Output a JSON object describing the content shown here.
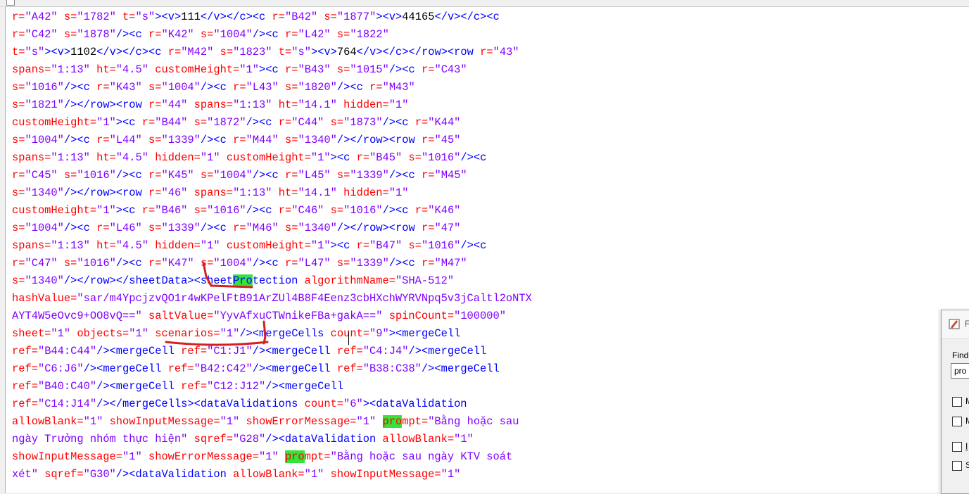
{
  "lines": [
    [
      {
        "t": "r=",
        "c": "attr"
      },
      {
        "t": "\"A42\"",
        "c": "val"
      },
      {
        "t": " s=",
        "c": "attr"
      },
      {
        "t": "\"1782\"",
        "c": "val"
      },
      {
        "t": " t=",
        "c": "attr"
      },
      {
        "t": "\"s\"",
        "c": "val"
      },
      {
        "t": "><v>",
        "c": "tag"
      },
      {
        "t": "111",
        "c": "text"
      },
      {
        "t": "</v></c><c",
        "c": "tag"
      },
      {
        "t": " r=",
        "c": "attr"
      },
      {
        "t": "\"B42\"",
        "c": "val"
      },
      {
        "t": " s=",
        "c": "attr"
      },
      {
        "t": "\"1877\"",
        "c": "val"
      },
      {
        "t": "><v>",
        "c": "tag"
      },
      {
        "t": "44165",
        "c": "text"
      },
      {
        "t": "</v></c><c",
        "c": "tag"
      }
    ],
    [
      {
        "t": "r=",
        "c": "attr"
      },
      {
        "t": "\"C42\"",
        "c": "val"
      },
      {
        "t": " s=",
        "c": "attr"
      },
      {
        "t": "\"1878\"",
        "c": "val"
      },
      {
        "t": "/><c",
        "c": "tag"
      },
      {
        "t": " r=",
        "c": "attr"
      },
      {
        "t": "\"K42\"",
        "c": "val"
      },
      {
        "t": " s=",
        "c": "attr"
      },
      {
        "t": "\"1004\"",
        "c": "val"
      },
      {
        "t": "/><c",
        "c": "tag"
      },
      {
        "t": " r=",
        "c": "attr"
      },
      {
        "t": "\"L42\"",
        "c": "val"
      },
      {
        "t": " s=",
        "c": "attr"
      },
      {
        "t": "\"1822\"",
        "c": "val"
      }
    ],
    [
      {
        "t": "t=",
        "c": "attr"
      },
      {
        "t": "\"s\"",
        "c": "val"
      },
      {
        "t": "><v>",
        "c": "tag"
      },
      {
        "t": "1102",
        "c": "text"
      },
      {
        "t": "</v></c><c",
        "c": "tag"
      },
      {
        "t": " r=",
        "c": "attr"
      },
      {
        "t": "\"M42\"",
        "c": "val"
      },
      {
        "t": " s=",
        "c": "attr"
      },
      {
        "t": "\"1823\"",
        "c": "val"
      },
      {
        "t": " t=",
        "c": "attr"
      },
      {
        "t": "\"s\"",
        "c": "val"
      },
      {
        "t": "><v>",
        "c": "tag"
      },
      {
        "t": "764",
        "c": "text"
      },
      {
        "t": "</v></c></row><row",
        "c": "tag"
      },
      {
        "t": " r=",
        "c": "attr"
      },
      {
        "t": "\"43\"",
        "c": "val"
      }
    ],
    [
      {
        "t": "spans=",
        "c": "attr"
      },
      {
        "t": "\"1:13\"",
        "c": "val"
      },
      {
        "t": " ht=",
        "c": "attr"
      },
      {
        "t": "\"4.5\"",
        "c": "val"
      },
      {
        "t": " customHeight=",
        "c": "attr"
      },
      {
        "t": "\"1\"",
        "c": "val"
      },
      {
        "t": "><c",
        "c": "tag"
      },
      {
        "t": " r=",
        "c": "attr"
      },
      {
        "t": "\"B43\"",
        "c": "val"
      },
      {
        "t": " s=",
        "c": "attr"
      },
      {
        "t": "\"1015\"",
        "c": "val"
      },
      {
        "t": "/><c",
        "c": "tag"
      },
      {
        "t": " r=",
        "c": "attr"
      },
      {
        "t": "\"C43\"",
        "c": "val"
      }
    ],
    [
      {
        "t": "s=",
        "c": "attr"
      },
      {
        "t": "\"1016\"",
        "c": "val"
      },
      {
        "t": "/><c",
        "c": "tag"
      },
      {
        "t": " r=",
        "c": "attr"
      },
      {
        "t": "\"K43\"",
        "c": "val"
      },
      {
        "t": " s=",
        "c": "attr"
      },
      {
        "t": "\"1004\"",
        "c": "val"
      },
      {
        "t": "/><c",
        "c": "tag"
      },
      {
        "t": " r=",
        "c": "attr"
      },
      {
        "t": "\"L43\"",
        "c": "val"
      },
      {
        "t": " s=",
        "c": "attr"
      },
      {
        "t": "\"1820\"",
        "c": "val"
      },
      {
        "t": "/><c",
        "c": "tag"
      },
      {
        "t": " r=",
        "c": "attr"
      },
      {
        "t": "\"M43\"",
        "c": "val"
      }
    ],
    [
      {
        "t": "s=",
        "c": "attr"
      },
      {
        "t": "\"1821\"",
        "c": "val"
      },
      {
        "t": "/></row><row",
        "c": "tag"
      },
      {
        "t": " r=",
        "c": "attr"
      },
      {
        "t": "\"44\"",
        "c": "val"
      },
      {
        "t": " spans=",
        "c": "attr"
      },
      {
        "t": "\"1:13\"",
        "c": "val"
      },
      {
        "t": " ht=",
        "c": "attr"
      },
      {
        "t": "\"14.1\"",
        "c": "val"
      },
      {
        "t": " hidden=",
        "c": "attr"
      },
      {
        "t": "\"1\"",
        "c": "val"
      }
    ],
    [
      {
        "t": "customHeight=",
        "c": "attr"
      },
      {
        "t": "\"1\"",
        "c": "val"
      },
      {
        "t": "><c",
        "c": "tag"
      },
      {
        "t": " r=",
        "c": "attr"
      },
      {
        "t": "\"B44\"",
        "c": "val"
      },
      {
        "t": " s=",
        "c": "attr"
      },
      {
        "t": "\"1872\"",
        "c": "val"
      },
      {
        "t": "/><c",
        "c": "tag"
      },
      {
        "t": " r=",
        "c": "attr"
      },
      {
        "t": "\"C44\"",
        "c": "val"
      },
      {
        "t": " s=",
        "c": "attr"
      },
      {
        "t": "\"1873\"",
        "c": "val"
      },
      {
        "t": "/><c",
        "c": "tag"
      },
      {
        "t": " r=",
        "c": "attr"
      },
      {
        "t": "\"K44\"",
        "c": "val"
      }
    ],
    [
      {
        "t": "s=",
        "c": "attr"
      },
      {
        "t": "\"1004\"",
        "c": "val"
      },
      {
        "t": "/><c",
        "c": "tag"
      },
      {
        "t": " r=",
        "c": "attr"
      },
      {
        "t": "\"L44\"",
        "c": "val"
      },
      {
        "t": " s=",
        "c": "attr"
      },
      {
        "t": "\"1339\"",
        "c": "val"
      },
      {
        "t": "/><c",
        "c": "tag"
      },
      {
        "t": " r=",
        "c": "attr"
      },
      {
        "t": "\"M44\"",
        "c": "val"
      },
      {
        "t": " s=",
        "c": "attr"
      },
      {
        "t": "\"1340\"",
        "c": "val"
      },
      {
        "t": "/></row><row",
        "c": "tag"
      },
      {
        "t": " r=",
        "c": "attr"
      },
      {
        "t": "\"45\"",
        "c": "val"
      }
    ],
    [
      {
        "t": "spans=",
        "c": "attr"
      },
      {
        "t": "\"1:13\"",
        "c": "val"
      },
      {
        "t": " ht=",
        "c": "attr"
      },
      {
        "t": "\"4.5\"",
        "c": "val"
      },
      {
        "t": " hidden=",
        "c": "attr"
      },
      {
        "t": "\"1\"",
        "c": "val"
      },
      {
        "t": " customHeight=",
        "c": "attr"
      },
      {
        "t": "\"1\"",
        "c": "val"
      },
      {
        "t": "><c",
        "c": "tag"
      },
      {
        "t": " r=",
        "c": "attr"
      },
      {
        "t": "\"B45\"",
        "c": "val"
      },
      {
        "t": " s=",
        "c": "attr"
      },
      {
        "t": "\"1016\"",
        "c": "val"
      },
      {
        "t": "/><c",
        "c": "tag"
      }
    ],
    [
      {
        "t": "r=",
        "c": "attr"
      },
      {
        "t": "\"C45\"",
        "c": "val"
      },
      {
        "t": " s=",
        "c": "attr"
      },
      {
        "t": "\"1016\"",
        "c": "val"
      },
      {
        "t": "/><c",
        "c": "tag"
      },
      {
        "t": " r=",
        "c": "attr"
      },
      {
        "t": "\"K45\"",
        "c": "val"
      },
      {
        "t": " s=",
        "c": "attr"
      },
      {
        "t": "\"1004\"",
        "c": "val"
      },
      {
        "t": "/><c",
        "c": "tag"
      },
      {
        "t": " r=",
        "c": "attr"
      },
      {
        "t": "\"L45\"",
        "c": "val"
      },
      {
        "t": " s=",
        "c": "attr"
      },
      {
        "t": "\"1339\"",
        "c": "val"
      },
      {
        "t": "/><c",
        "c": "tag"
      },
      {
        "t": " r=",
        "c": "attr"
      },
      {
        "t": "\"M45\"",
        "c": "val"
      }
    ],
    [
      {
        "t": "s=",
        "c": "attr"
      },
      {
        "t": "\"1340\"",
        "c": "val"
      },
      {
        "t": "/></row><row",
        "c": "tag"
      },
      {
        "t": " r=",
        "c": "attr"
      },
      {
        "t": "\"46\"",
        "c": "val"
      },
      {
        "t": " spans=",
        "c": "attr"
      },
      {
        "t": "\"1:13\"",
        "c": "val"
      },
      {
        "t": " ht=",
        "c": "attr"
      },
      {
        "t": "\"14.1\"",
        "c": "val"
      },
      {
        "t": " hidden=",
        "c": "attr"
      },
      {
        "t": "\"1\"",
        "c": "val"
      }
    ],
    [
      {
        "t": "customHeight=",
        "c": "attr"
      },
      {
        "t": "\"1\"",
        "c": "val"
      },
      {
        "t": "><c",
        "c": "tag"
      },
      {
        "t": " r=",
        "c": "attr"
      },
      {
        "t": "\"B46\"",
        "c": "val"
      },
      {
        "t": " s=",
        "c": "attr"
      },
      {
        "t": "\"1016\"",
        "c": "val"
      },
      {
        "t": "/><c",
        "c": "tag"
      },
      {
        "t": " r=",
        "c": "attr"
      },
      {
        "t": "\"C46\"",
        "c": "val"
      },
      {
        "t": " s=",
        "c": "attr"
      },
      {
        "t": "\"1016\"",
        "c": "val"
      },
      {
        "t": "/><c",
        "c": "tag"
      },
      {
        "t": " r=",
        "c": "attr"
      },
      {
        "t": "\"K46\"",
        "c": "val"
      }
    ],
    [
      {
        "t": "s=",
        "c": "attr"
      },
      {
        "t": "\"1004\"",
        "c": "val"
      },
      {
        "t": "/><c",
        "c": "tag"
      },
      {
        "t": " r=",
        "c": "attr"
      },
      {
        "t": "\"L46\"",
        "c": "val"
      },
      {
        "t": " s=",
        "c": "attr"
      },
      {
        "t": "\"1339\"",
        "c": "val"
      },
      {
        "t": "/><c",
        "c": "tag"
      },
      {
        "t": " r=",
        "c": "attr"
      },
      {
        "t": "\"M46\"",
        "c": "val"
      },
      {
        "t": " s=",
        "c": "attr"
      },
      {
        "t": "\"1340\"",
        "c": "val"
      },
      {
        "t": "/></row><row",
        "c": "tag"
      },
      {
        "t": " r=",
        "c": "attr"
      },
      {
        "t": "\"47\"",
        "c": "val"
      }
    ],
    [
      {
        "t": "spans=",
        "c": "attr"
      },
      {
        "t": "\"1:13\"",
        "c": "val"
      },
      {
        "t": " ht=",
        "c": "attr"
      },
      {
        "t": "\"4.5\"",
        "c": "val"
      },
      {
        "t": " hidden=",
        "c": "attr"
      },
      {
        "t": "\"1\"",
        "c": "val"
      },
      {
        "t": " customHeight=",
        "c": "attr"
      },
      {
        "t": "\"1\"",
        "c": "val"
      },
      {
        "t": "><c",
        "c": "tag"
      },
      {
        "t": " r=",
        "c": "attr"
      },
      {
        "t": "\"B47\"",
        "c": "val"
      },
      {
        "t": " s=",
        "c": "attr"
      },
      {
        "t": "\"1016\"",
        "c": "val"
      },
      {
        "t": "/><c",
        "c": "tag"
      }
    ],
    [
      {
        "t": "r=",
        "c": "attr"
      },
      {
        "t": "\"C47\"",
        "c": "val"
      },
      {
        "t": " s=",
        "c": "attr"
      },
      {
        "t": "\"1016\"",
        "c": "val"
      },
      {
        "t": "/><c",
        "c": "tag"
      },
      {
        "t": " r=",
        "c": "attr"
      },
      {
        "t": "\"K47\"",
        "c": "val"
      },
      {
        "t": " s=",
        "c": "attr"
      },
      {
        "t": "\"1004\"",
        "c": "val"
      },
      {
        "t": "/><c",
        "c": "tag"
      },
      {
        "t": " r=",
        "c": "attr"
      },
      {
        "t": "\"L47\"",
        "c": "val"
      },
      {
        "t": " s=",
        "c": "attr"
      },
      {
        "t": "\"1339\"",
        "c": "val"
      },
      {
        "t": "/><c",
        "c": "tag"
      },
      {
        "t": " r=",
        "c": "attr"
      },
      {
        "t": "\"M47\"",
        "c": "val"
      }
    ],
    [
      {
        "t": "s=",
        "c": "attr"
      },
      {
        "t": "\"1340\"",
        "c": "val"
      },
      {
        "t": "/></row></sheetData><sheet",
        "c": "tag"
      },
      {
        "t": "Pro",
        "c": "tag hl"
      },
      {
        "t": "tection",
        "c": "tag"
      },
      {
        "t": " algorithmName=",
        "c": "attr"
      },
      {
        "t": "\"SHA-512\"",
        "c": "val"
      }
    ],
    [
      {
        "t": "hashValue=",
        "c": "attr"
      },
      {
        "t": "\"sar/m4YpcjzvQO1r4wKPelFtB91ArZUl4B8F4Eenz3cbHXchWYRVNpq5v3jCaltl2oNTX",
        "c": "val"
      }
    ],
    [
      {
        "t": "AYT4W5eOvc9+OO8vQ==\"",
        "c": "val"
      },
      {
        "t": " saltValue=",
        "c": "attr"
      },
      {
        "t": "\"YyvAfxuCTWnikeFBa+gakA==\"",
        "c": "val"
      },
      {
        "t": " spinCount=",
        "c": "attr"
      },
      {
        "t": "\"100000\"",
        "c": "val"
      }
    ],
    [
      {
        "t": "sheet=",
        "c": "attr"
      },
      {
        "t": "\"1\"",
        "c": "val"
      },
      {
        "t": " objects=",
        "c": "attr"
      },
      {
        "t": "\"1\"",
        "c": "val"
      },
      {
        "t": " scenarios=",
        "c": "attr"
      },
      {
        "t": "\"1\"",
        "c": "val"
      },
      {
        "t": "/><mergeCells",
        "c": "tag"
      },
      {
        "t": " count=",
        "c": "attr"
      },
      {
        "t": "\"9\"",
        "c": "val"
      },
      {
        "t": "><mergeCell",
        "c": "tag"
      }
    ],
    [
      {
        "t": "ref=",
        "c": "attr"
      },
      {
        "t": "\"B44:C44\"",
        "c": "val"
      },
      {
        "t": "/><mergeCell",
        "c": "tag"
      },
      {
        "t": " ref=",
        "c": "attr"
      },
      {
        "t": "\"C1:J1\"",
        "c": "val"
      },
      {
        "t": "/><mergeCell",
        "c": "tag"
      },
      {
        "t": " ref=",
        "c": "attr"
      },
      {
        "t": "\"C4:J4\"",
        "c": "val"
      },
      {
        "t": "/><mergeCell",
        "c": "tag"
      }
    ],
    [
      {
        "t": "ref=",
        "c": "attr"
      },
      {
        "t": "\"C6:J6\"",
        "c": "val"
      },
      {
        "t": "/><mergeCell",
        "c": "tag"
      },
      {
        "t": " ref=",
        "c": "attr"
      },
      {
        "t": "\"B42:C42\"",
        "c": "val"
      },
      {
        "t": "/><mergeCell",
        "c": "tag"
      },
      {
        "t": " ref=",
        "c": "attr"
      },
      {
        "t": "\"B38:C38\"",
        "c": "val"
      },
      {
        "t": "/><mergeCell",
        "c": "tag"
      }
    ],
    [
      {
        "t": "ref=",
        "c": "attr"
      },
      {
        "t": "\"B40:C40\"",
        "c": "val"
      },
      {
        "t": "/><mergeCell",
        "c": "tag"
      },
      {
        "t": " ref=",
        "c": "attr"
      },
      {
        "t": "\"C12:J12\"",
        "c": "val"
      },
      {
        "t": "/><mergeCell",
        "c": "tag"
      }
    ],
    [
      {
        "t": "ref=",
        "c": "attr"
      },
      {
        "t": "\"C14:J14\"",
        "c": "val"
      },
      {
        "t": "/></mergeCells><dataValidations",
        "c": "tag"
      },
      {
        "t": " count=",
        "c": "attr"
      },
      {
        "t": "\"6\"",
        "c": "val"
      },
      {
        "t": "><dataValidation",
        "c": "tag"
      }
    ],
    [
      {
        "t": "allowBlank=",
        "c": "attr"
      },
      {
        "t": "\"1\"",
        "c": "val"
      },
      {
        "t": " showInputMessage=",
        "c": "attr"
      },
      {
        "t": "\"1\"",
        "c": "val"
      },
      {
        "t": " showErrorMessage=",
        "c": "attr"
      },
      {
        "t": "\"1\"",
        "c": "val"
      },
      {
        "t": " ",
        "c": "attr"
      },
      {
        "t": "pro",
        "c": "attr hl"
      },
      {
        "t": "mpt=",
        "c": "attr"
      },
      {
        "t": "\"Bằng hoặc sau",
        "c": "val"
      }
    ],
    [
      {
        "t": "ngày Trưởng nhóm thực hiện\"",
        "c": "val"
      },
      {
        "t": " sqref=",
        "c": "attr"
      },
      {
        "t": "\"G28\"",
        "c": "val"
      },
      {
        "t": "/><dataValidation",
        "c": "tag"
      },
      {
        "t": " allowBlank=",
        "c": "attr"
      },
      {
        "t": "\"1\"",
        "c": "val"
      }
    ],
    [
      {
        "t": "showInputMessage=",
        "c": "attr"
      },
      {
        "t": "\"1\"",
        "c": "val"
      },
      {
        "t": " showErrorMessage=",
        "c": "attr"
      },
      {
        "t": "\"1\"",
        "c": "val"
      },
      {
        "t": " ",
        "c": "attr"
      },
      {
        "t": "pro",
        "c": "attr hl"
      },
      {
        "t": "mpt=",
        "c": "attr"
      },
      {
        "t": "\"Bằng hoặc sau ngày KTV soát",
        "c": "val"
      }
    ],
    [
      {
        "t": "xét\"",
        "c": "val"
      },
      {
        "t": " sqref=",
        "c": "attr"
      },
      {
        "t": "\"G30\"",
        "c": "val"
      },
      {
        "t": "/><dataValidation",
        "c": "tag"
      },
      {
        "t": " allowBlank=",
        "c": "attr"
      },
      {
        "t": "\"1\"",
        "c": "val"
      },
      {
        "t": " showInputMessage=",
        "c": "attr"
      },
      {
        "t": "\"1\"",
        "c": "val"
      }
    ]
  ],
  "colors": {
    "tag": "#0000ff",
    "attr": "#ff0000",
    "val": "#8000ff",
    "text": "#000000",
    "highlight": "#34e43a",
    "annotation": "#d42020"
  },
  "find_dialog": {
    "title": "F",
    "find_label": "Find",
    "find_value": "pro",
    "options": [
      "M",
      "M",
      "I",
      "S"
    ]
  }
}
